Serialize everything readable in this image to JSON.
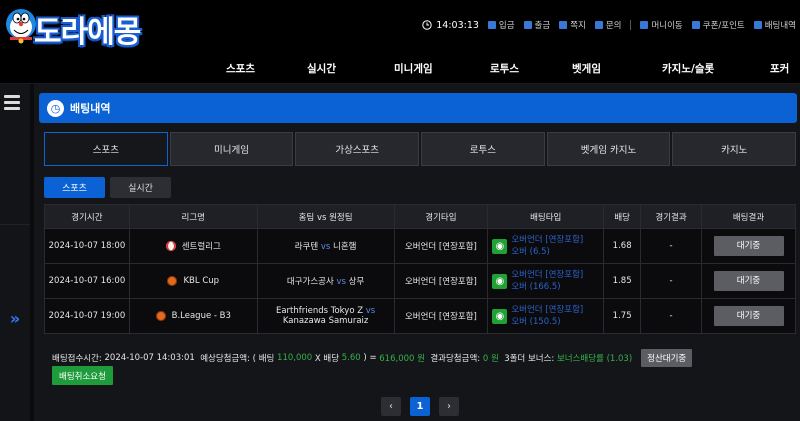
{
  "brand": {
    "logo_text": "도라에몽"
  },
  "topbar": {
    "time": "14:03:13",
    "items": [
      "입금",
      "출금",
      "쪽지",
      "문의",
      "머니이동",
      "쿠폰/포인트",
      "배팅내역"
    ]
  },
  "nav": [
    "스포츠",
    "실시간",
    "미니게임",
    "로투스",
    "벳게임",
    "카지노/슬롯",
    "포커"
  ],
  "page": {
    "title": "배팅내역"
  },
  "tabs": [
    "스포츠",
    "미니게임",
    "가상스포츠",
    "로투스",
    "벳게임 카지노",
    "카지노"
  ],
  "subtabs": [
    "스포츠",
    "실시간"
  ],
  "table": {
    "headers": [
      "경기시간",
      "리그명",
      "홈팀 vs 원정팀",
      "경기타입",
      "배팅타입",
      "배당",
      "경기결과",
      "배팅결과"
    ],
    "rows": [
      {
        "time": "2024-10-07 18:00",
        "league_icon": "baseball-icon",
        "league": "센트럴리그",
        "home": "라쿠텐",
        "vs": "vs",
        "away": "니혼햄",
        "type": "오버언더 [연장포함]",
        "bet_line1": "오버언더 [연장포함]",
        "bet_line2": "오버 (6.5)",
        "odds": "1.68",
        "result": "-",
        "status": "대기중"
      },
      {
        "time": "2024-10-07 16:00",
        "league_icon": "basketball-icon",
        "league": "KBL Cup",
        "home": "대구가스공사",
        "vs": "vs",
        "away": "상무",
        "type": "오버언더 [연장포함]",
        "bet_line1": "오버언더 [연장포함]",
        "bet_line2": "오버 (166.5)",
        "odds": "1.85",
        "result": "-",
        "status": "대기중"
      },
      {
        "time": "2024-10-07 19:00",
        "league_icon": "basketball-icon",
        "league": "B.League - B3",
        "home": "Earthfriends Tokyo Z",
        "vs": "vs",
        "away": "Kanazawa Samuraiz",
        "type": "오버언더 [연장포함]",
        "bet_line1": "오버언더 [연장포함]",
        "bet_line2": "오버 (150.5)",
        "odds": "1.75",
        "result": "-",
        "status": "대기중"
      }
    ]
  },
  "summary": {
    "time_label": "배팅접수시간:",
    "time": "2024-10-07 14:03:01",
    "expected_label": "예상당첨금액: ( 배팅",
    "stake": "110,000",
    "x_odds_label": "X 배당",
    "total_odds": "5.60",
    "equals": ") =",
    "expected_amount": "616,000 원",
    "result_label": "결과당첨금액:",
    "result_amount": "0 원",
    "bonus_label": "3폴더 보너스:",
    "bonus_value": "보너스배당률 (1.03)",
    "pending_label": "정산대기중",
    "cancel_label": "배팅취소요청"
  },
  "pagination": {
    "prev": "‹",
    "current": "1",
    "next": "›"
  },
  "colors": {
    "accent": "#0b62d4",
    "green": "#35b14b",
    "link": "#2c63c9"
  }
}
